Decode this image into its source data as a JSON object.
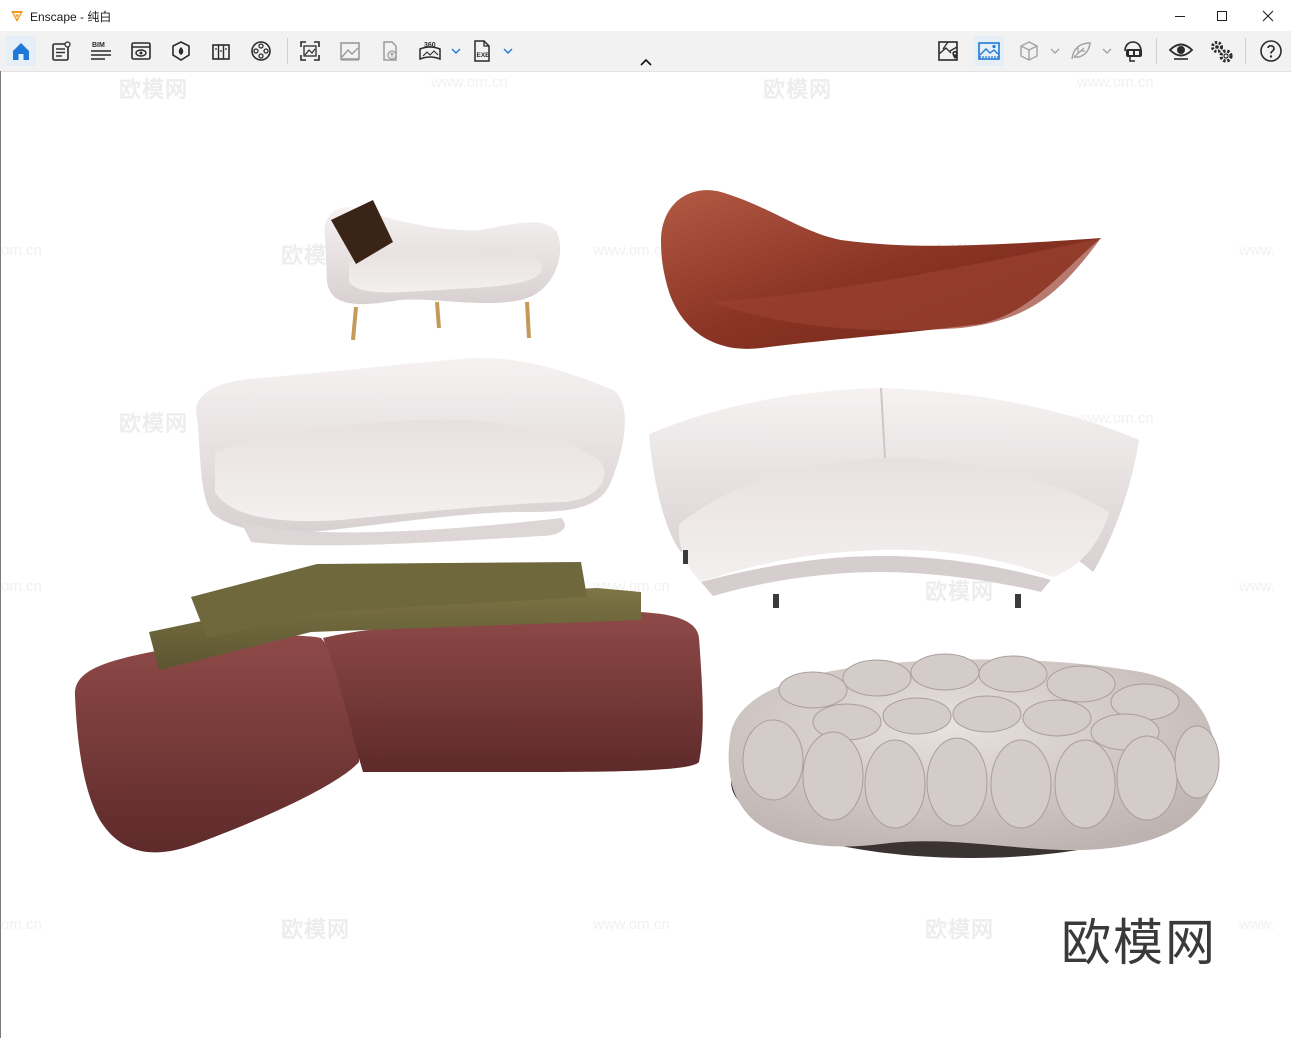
{
  "window": {
    "app_name": "Enscape",
    "separator": " - ",
    "document": "纯白",
    "controls": [
      "minimize-icon",
      "maximize-icon",
      "close-icon"
    ]
  },
  "toolbar": {
    "left_tools": [
      {
        "name": "home-icon",
        "active": true
      },
      {
        "name": "project-info-icon"
      },
      {
        "name": "bim-icon",
        "label": "BIM"
      },
      {
        "name": "view-management-icon"
      },
      {
        "name": "material-editor-icon"
      },
      {
        "name": "asset-library-icon"
      },
      {
        "name": "video-editor-icon"
      },
      {
        "name": "screenshot-icon"
      },
      {
        "name": "batch-render-icon"
      },
      {
        "name": "upload-icon"
      },
      {
        "name": "panorama-360-icon",
        "label": "360"
      },
      {
        "name": "export-exe-icon",
        "label": "EXE"
      }
    ],
    "right_tools": [
      {
        "name": "map-location-icon"
      },
      {
        "name": "scene-view-icon"
      },
      {
        "name": "cube-icon"
      },
      {
        "name": "leaf-icon"
      },
      {
        "name": "vr-headset-icon"
      },
      {
        "name": "live-update-eye-icon"
      },
      {
        "name": "settings-gears-icon"
      },
      {
        "name": "help-icon"
      }
    ]
  },
  "viewport": {
    "watermark_brand": "欧模网",
    "watermark_url": "www.om.cn",
    "watermark_url_partial_left": "om.cn",
    "watermark_url_partial_right": "www.",
    "brand_mark": "欧模网",
    "models": [
      "chaise-sofa-white",
      "sculptural-lounger-rust",
      "curved-sofa-white",
      "arc-sectional-sofa-white",
      "modular-sofa-burgundy-olive",
      "bubble-sofa-boucle"
    ],
    "colors": {
      "rust": "#8a3424",
      "white_fabric": "#efe9ea",
      "burgundy": "#7a3a3a",
      "olive": "#6b6438",
      "boucle": "#d9d2cf"
    }
  }
}
